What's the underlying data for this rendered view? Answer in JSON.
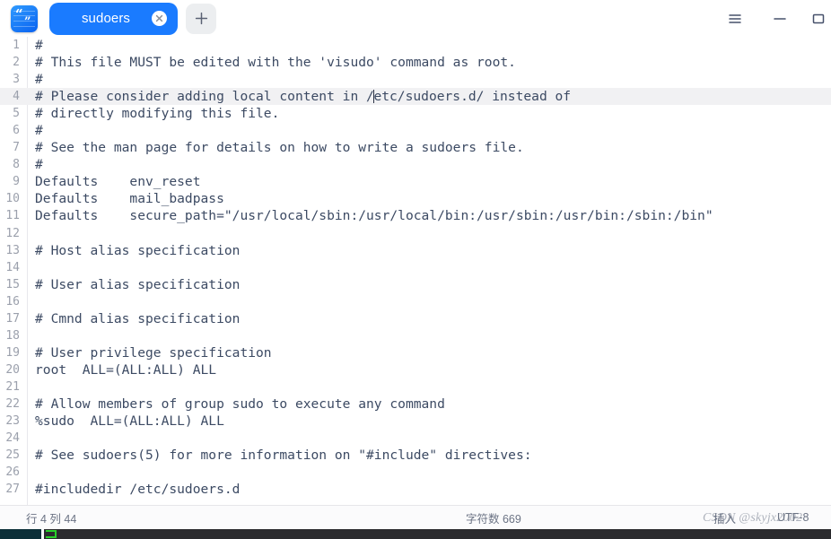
{
  "window": {
    "app_icon_name": "book-quote-icon",
    "menu_icon": "hamburger-menu-icon",
    "minimize_icon": "minimize-icon",
    "maximize_icon": "maximize-icon"
  },
  "tabs": [
    {
      "label": "sudoers",
      "close_icon": "close-icon",
      "active": true
    }
  ],
  "newtab": {
    "label": "+",
    "icon": "plus-icon"
  },
  "editor": {
    "language": "text",
    "active_line": 4,
    "caret_column": 44,
    "lines": [
      {
        "n": "1",
        "text": "#"
      },
      {
        "n": "2",
        "text": "# This file MUST be edited with the 'visudo' command as root."
      },
      {
        "n": "3",
        "text": "#"
      },
      {
        "n": "4",
        "text": "# Please consider adding local content in /etc/sudoers.d/ instead of"
      },
      {
        "n": "5",
        "text": "# directly modifying this file."
      },
      {
        "n": "6",
        "text": "#"
      },
      {
        "n": "7",
        "text": "# See the man page for details on how to write a sudoers file."
      },
      {
        "n": "8",
        "text": "#"
      },
      {
        "n": "9",
        "text": "Defaults\tenv_reset"
      },
      {
        "n": "10",
        "text": "Defaults\tmail_badpass"
      },
      {
        "n": "11",
        "text": "Defaults\tsecure_path=\"/usr/local/sbin:/usr/local/bin:/usr/sbin:/usr/bin:/sbin:/bin\""
      },
      {
        "n": "12",
        "text": ""
      },
      {
        "n": "13",
        "text": "# Host alias specification"
      },
      {
        "n": "14",
        "text": ""
      },
      {
        "n": "15",
        "text": "# User alias specification"
      },
      {
        "n": "16",
        "text": ""
      },
      {
        "n": "17",
        "text": "# Cmnd alias specification"
      },
      {
        "n": "18",
        "text": ""
      },
      {
        "n": "19",
        "text": "# User privilege specification"
      },
      {
        "n": "20",
        "text": "root  ALL=(ALL:ALL) ALL"
      },
      {
        "n": "21",
        "text": ""
      },
      {
        "n": "22",
        "text": "# Allow members of group sudo to execute any command"
      },
      {
        "n": "23",
        "text": "%sudo  ALL=(ALL:ALL) ALL"
      },
      {
        "n": "24",
        "text": ""
      },
      {
        "n": "25",
        "text": "# See sudoers(5) for more information on \"#include\" directives:"
      },
      {
        "n": "26",
        "text": ""
      },
      {
        "n": "27",
        "text": "#includedir /etc/sudoers.d"
      }
    ],
    "line4_before_caret": "# Please consider adding local content in /",
    "line4_after_caret": "etc/sudoers.d/ instead of"
  },
  "statusbar": {
    "cursor_position": "行 4 列 44",
    "char_count": "字符数 669",
    "input_mode": "插入",
    "encoding": "UTF-8"
  },
  "watermark": {
    "text": "CSDN @skyjx2002"
  },
  "colors": {
    "tab_active": "#1a7bff",
    "text": "#3c4a63",
    "gutter_text": "#9ba0ac",
    "active_line_bg": "#f1f1f3",
    "newtab_bg": "#eceef0",
    "statusbar_bg": "#fbfbfc",
    "taskbar_bg": "#2b2b2e",
    "taskbar_teal": "#0c2f38",
    "taskbar_green": "#2ad02a"
  }
}
